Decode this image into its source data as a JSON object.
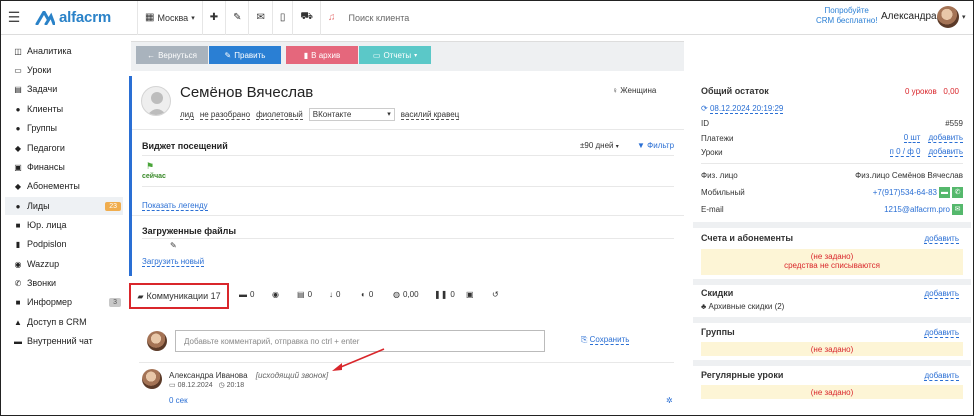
{
  "topbar": {
    "city": "Москва",
    "search_placeholder": "Поиск клиента",
    "try_line1": "Попробуйте",
    "try_line2": "CRM бесплатно!",
    "user_name": "Александра",
    "logo": "alfacrm"
  },
  "sidebar": {
    "items": [
      {
        "label": "Аналитика",
        "icon": "chart-icon",
        "glyph": "◫"
      },
      {
        "label": "Уроки",
        "icon": "calendar-icon",
        "glyph": "▭"
      },
      {
        "label": "Задачи",
        "icon": "tasks-icon",
        "glyph": "▤"
      },
      {
        "label": "Клиенты",
        "icon": "user-icon",
        "glyph": "●"
      },
      {
        "label": "Группы",
        "icon": "group-icon",
        "glyph": "●"
      },
      {
        "label": "Педагоги",
        "icon": "graduation-icon",
        "glyph": "◆"
      },
      {
        "label": "Финансы",
        "icon": "money-icon",
        "glyph": "▣"
      },
      {
        "label": "Абонементы",
        "icon": "tag-icon",
        "glyph": "◆"
      },
      {
        "label": "Лиды",
        "icon": "user-plus-icon",
        "glyph": "●",
        "badge": "23"
      },
      {
        "label": "Юр. лица",
        "icon": "briefcase-icon",
        "glyph": "■"
      },
      {
        "label": "Podpislon",
        "icon": "file-icon",
        "glyph": "▮"
      },
      {
        "label": "Wazzup",
        "icon": "whatsapp-icon",
        "glyph": "◉"
      },
      {
        "label": "Звонки",
        "icon": "phone-icon",
        "glyph": "✆"
      },
      {
        "label": "Информер",
        "icon": "inbox-icon",
        "glyph": "■",
        "badge": "3"
      },
      {
        "label": "Доступ в CRM",
        "icon": "lock-icon",
        "glyph": "▲"
      },
      {
        "label": "Внутренний чат",
        "icon": "chat-icon",
        "glyph": "▬"
      }
    ]
  },
  "toolbar": {
    "back": "Вернуться",
    "edit": "Править",
    "archive": "В архив",
    "reports": "Отчеты"
  },
  "lead": {
    "name": "Семёнов Вячеслав",
    "gender": "Женщина",
    "tag1": "лид",
    "tag2": "не разобрано",
    "tag3": "фиолетовый",
    "source": "ВКонтакте",
    "manager": "василий кравец"
  },
  "widget": {
    "title": "Виджет посещений",
    "period": "±90 дней",
    "filter": "Фильтр",
    "now": "сейчас",
    "legend": "Показать легенду"
  },
  "files": {
    "title": "Загруженные файлы",
    "upload": "Загрузить новый"
  },
  "tabs": {
    "comms": "Коммуникации 17",
    "t1": "0",
    "t2": "0",
    "t3": "0",
    "t4": "0",
    "t5": "0,00",
    "t6": "0"
  },
  "comment": {
    "placeholder": "Добавьте комментарий, отправка по ctrl + enter",
    "save": "Сохранить",
    "author": "Александра Иванова",
    "type": "[исходящий звонок]",
    "date": "08.12.2024",
    "time": "20:18",
    "duration": "0 сек"
  },
  "right": {
    "balance_title": "Общий остаток",
    "balance_value": "0 уроков   0,00",
    "balance_date": "08.12.2024 20:19:29",
    "id_label": "ID",
    "id_value": "#559",
    "payments_label": "Платежи",
    "payments_value": "0 шт",
    "payments_add": "добавить",
    "lessons_label": "Уроки",
    "lessons_value": "п 0 / ф 0",
    "lessons_add": "добавить",
    "person_label": "Физ. лицо",
    "person_value": "Физ.лицо Семёнов Вячеслав",
    "mobile_label": "Мобильный",
    "mobile_value": "+7(917)534-64-83",
    "email_label": "E-mail",
    "email_value": "1215@alfacrm.pro",
    "accounts_title": "Счета и абонементы",
    "accounts_add": "добавить",
    "accounts_empty": "(не задано)",
    "accounts_note": "средства не списываются",
    "discounts_title": "Скидки",
    "discounts_add": "добавить",
    "discounts_archived": "Архивные скидки (2)",
    "groups_title": "Группы",
    "groups_add": "добавить",
    "groups_empty": "(не задано)",
    "regular_title": "Регулярные уроки",
    "regular_add": "добавить",
    "regular_empty": "(не задано)"
  },
  "colors": {
    "accent": "#2a6fd4",
    "green": "#5cb85c",
    "red": "#d9534f",
    "teal": "#5bc0de",
    "gray": "#9aa3ad",
    "warn_bg": "#fdf5d6"
  }
}
